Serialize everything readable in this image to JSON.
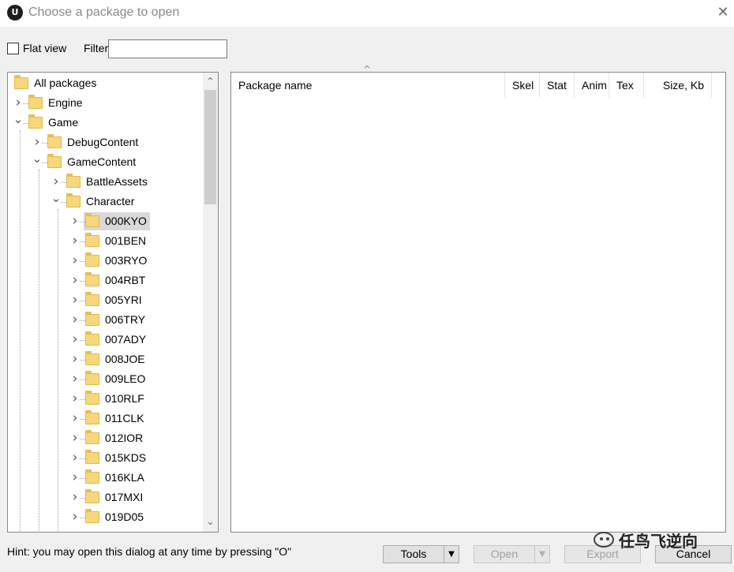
{
  "window": {
    "title": "Choose a package to open",
    "app_icon": "U",
    "close_glyph": "✕"
  },
  "toolbar": {
    "flat_view_label": "Flat view",
    "flat_view_checked": false,
    "filter_label": "Filter:",
    "filter_value": "",
    "filter_placeholder": ""
  },
  "tree": {
    "nodes": [
      {
        "label": "All packages",
        "depth": 0,
        "state": "none"
      },
      {
        "label": "Engine",
        "depth": 1,
        "state": "collapsed"
      },
      {
        "label": "Game",
        "depth": 1,
        "state": "expanded"
      },
      {
        "label": "DebugContent",
        "depth": 2,
        "state": "collapsed"
      },
      {
        "label": "GameContent",
        "depth": 2,
        "state": "expanded"
      },
      {
        "label": "BattleAssets",
        "depth": 3,
        "state": "collapsed"
      },
      {
        "label": "Character",
        "depth": 3,
        "state": "expanded"
      },
      {
        "label": "000KYO",
        "depth": 4,
        "state": "collapsed",
        "selected": true
      },
      {
        "label": "001BEN",
        "depth": 4,
        "state": "collapsed"
      },
      {
        "label": "003RYO",
        "depth": 4,
        "state": "collapsed"
      },
      {
        "label": "004RBT",
        "depth": 4,
        "state": "collapsed"
      },
      {
        "label": "005YRI",
        "depth": 4,
        "state": "collapsed"
      },
      {
        "label": "006TRY",
        "depth": 4,
        "state": "collapsed"
      },
      {
        "label": "007ADY",
        "depth": 4,
        "state": "collapsed"
      },
      {
        "label": "008JOE",
        "depth": 4,
        "state": "collapsed"
      },
      {
        "label": "009LEO",
        "depth": 4,
        "state": "collapsed"
      },
      {
        "label": "010RLF",
        "depth": 4,
        "state": "collapsed"
      },
      {
        "label": "011CLK",
        "depth": 4,
        "state": "collapsed"
      },
      {
        "label": "012IOR",
        "depth": 4,
        "state": "collapsed"
      },
      {
        "label": "015KDS",
        "depth": 4,
        "state": "collapsed"
      },
      {
        "label": "016KLA",
        "depth": 4,
        "state": "collapsed"
      },
      {
        "label": "017MXI",
        "depth": 4,
        "state": "collapsed"
      },
      {
        "label": "019D05",
        "depth": 4,
        "state": "collapsed"
      }
    ],
    "scroll_up_glyph": "⌃",
    "scroll_down_glyph": "⌄"
  },
  "list": {
    "sort_glyph": "^",
    "columns": [
      "Package name",
      "Skel",
      "Stat",
      "Anim",
      "Tex",
      "Size, Kb"
    ],
    "rows": []
  },
  "footer": {
    "hint": "Hint: you may open this dialog at any time by pressing \"O\"",
    "tools_label": "Tools",
    "open_label": "Open",
    "export_label": "Export",
    "cancel_label": "Cancel",
    "dropdown_glyph": "▼"
  },
  "watermark": {
    "text": "任鸟飞逆向"
  },
  "colors": {
    "folder": "#f6d77c",
    "selection": "#d9d9d9",
    "panel_border": "#828790"
  }
}
